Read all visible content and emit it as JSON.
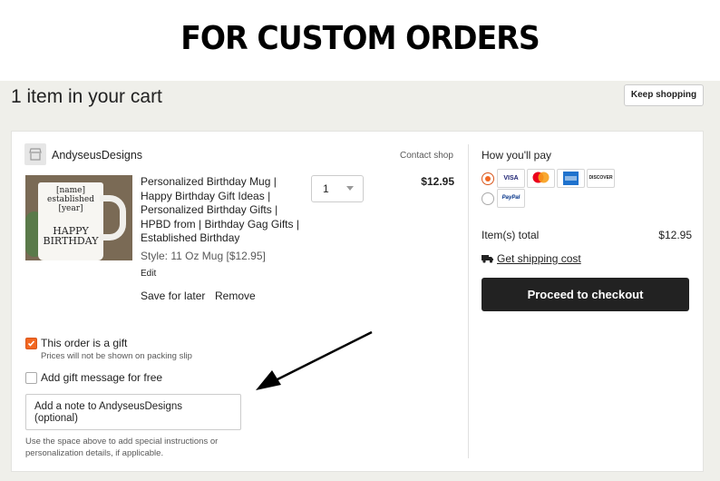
{
  "banner": {
    "title": "FOR CUSTOM ORDERS"
  },
  "cart": {
    "heading": "1 item in your cart",
    "keep_shopping": "Keep shopping"
  },
  "shop": {
    "name": "AndyseusDesigns",
    "contact": "Contact shop",
    "icon": "shop-icon"
  },
  "item": {
    "title": "Personalized Birthday Mug | Happy Birthday Gift Ideas | Personalized Birthday Gifts | HPBD from | Birthday Gag Gifts | Established Birthday",
    "style": "Style: 11 Oz Mug [$12.95]",
    "edit": "Edit",
    "save_for_later": "Save for later",
    "remove": "Remove",
    "quantity": "1",
    "price": "$12.95",
    "image_text": {
      "line1": "[name]",
      "line2": "established",
      "line3": "[year]",
      "line4": "HAPPY",
      "line5": "BIRTHDAY"
    }
  },
  "gift": {
    "checked": true,
    "label": "This order is a gift",
    "sub": "Prices will not be shown on packing slip",
    "message_label": "Add gift message for free",
    "message_checked": false
  },
  "note": {
    "placeholder": "Add a note to AndyseusDesigns (optional)",
    "help": "Use the space above to add special instructions or personalization details, if applicable."
  },
  "payment": {
    "heading": "How you'll pay",
    "options": [
      {
        "cards": [
          "VISA",
          "mastercard",
          "amex",
          "DISCOVER"
        ],
        "selected": true
      },
      {
        "cards": [
          "PayPal"
        ],
        "selected": false
      }
    ],
    "items_total_label": "Item(s) total",
    "items_total_value": "$12.95",
    "shipping_link": "Get shipping cost",
    "checkout": "Proceed to checkout"
  },
  "colors": {
    "accent": "#f26722",
    "button_dark": "#222222",
    "page_bg": "#efefea"
  }
}
